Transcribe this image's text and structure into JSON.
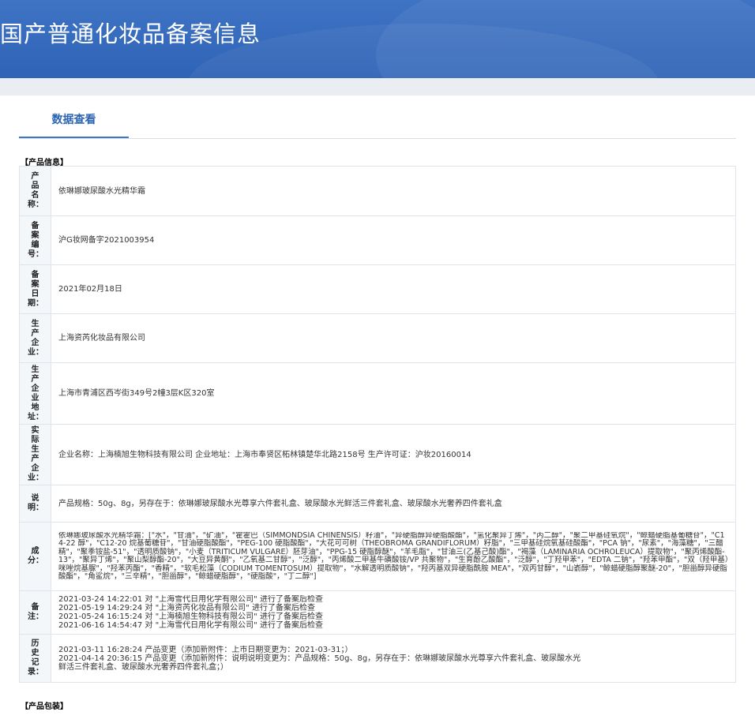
{
  "header": {
    "title": "国产普通化妆品备案信息"
  },
  "tabs": [
    {
      "label": "数据查看"
    }
  ],
  "product_info": {
    "section_label": "【产品信息】",
    "rows": [
      {
        "key": "产品名称：",
        "value": "依琳娜玻尿酸水光精华霜"
      },
      {
        "key": "备案编号：",
        "value": "沪G妆网备字2021003954"
      },
      {
        "key": "备案日期：",
        "value": "2021年02月18日"
      },
      {
        "key": "生产企业：",
        "value": "上海资芮化妆品有限公司"
      },
      {
        "key": "生产企业地址：",
        "value": "上海市青浦区西岑街349号2幢3层K区320室"
      },
      {
        "key": "实际生产企业：",
        "value": "企业名称：上海楠旭生物科技有限公司 企业地址：上海市奉贤区柘林镇楚华北路2158号 生产许可证：沪妆20160014"
      },
      {
        "key": "说明：",
        "value": "产品规格：50g、8g，另存在于：依琳娜玻尿酸水光尊享六件套礼盒、玻尿酸水光鲜活三件套礼盒、玻尿酸水光奢养四件套礼盒"
      },
      {
        "key": "成分：",
        "value": "依琳娜玻尿酸水光精华霜：[\"水\"，\"甘油\"，\"矿油\"，\"霍霍巴（SIMMONDSIA CHINENSIS）籽油\"，\"异硬脂醇异硬脂酸酯\"，\"氢化聚异丁烯\"，\"丙二醇\"，\"聚二甲基硅氧烷\"，\"鲸蜡硬脂基葡糖苷\"，\"C14-22 醇\"，\"C12-20 烷基葡糖苷\"，\"甘油硬脂酸酯\"，\"PEG-100 硬脂酸酯\"，\"大花可可树（THEOBROMA GRANDIFLORUM）籽脂\"，\"三甲基硅烷氧基硅酸酯\"，\"PCA 钠\"，\"尿素\"，\"海藻糖\"，\"三醋精\"，\"聚季铵盐-51\"，\"透明质酸钠\"，\"小麦（TRITICUM VULGARE）胚芽油\"，\"PPG-15 硬脂醇醚\"，\"羊毛脂\"，\"甘油三(乙基己酸)酯\"，\"褐藻（LAMINARIA OCHROLEUCA）提取物\"，\"聚丙烯酸酯-13\"，\"聚异丁烯\"，\"聚山梨醇酯-20\"，\"大豆异黄酮\"，\"乙氧基二甘醇\"，\"泛醇\"，\"丙烯酸二甲基牛磺酸铵/VP 共聚物\"，\"生育酚乙酸酯\"，\"泛醇\"，\"丁羟甲苯\"，\"EDTA 二钠\"，\"羟苯甲酯\"，\"双（羟甲基）咪唑烷基脲\"，\"羟苯丙酯\"，\"香精\"，\"软毛松藻（CODIUM TOMENTOSUM）提取物\"，\"水解透明质酸钠\"，\"羟丙基双异硬脂酰胺 MEA\"，\"双丙甘醇\"，\"山嵛醇\"，\"鲸蜡硬脂醇聚醚-20\"，\"胆甾醇异硬脂酸酯\"，\"角鲨烷\"，\"三辛精\"，\"胆甾醇\"，\"鲸蜡硬脂醇\"，\"硬脂酸\"，\"丁二醇\"]"
      },
      {
        "key": "备注：",
        "value": "2021-03-24 14:22:01 对 \"上海雪代日用化学有限公司\" 进行了备案后检查\n2021-05-19 14:29:24 对 \"上海资芮化妆品有限公司\" 进行了备案后检查\n2021-05-24 16:15:24 对 \"上海楠旭生物科技有限公司\" 进行了备案后检查\n2021-06-16 14:54:47 对 \"上海雪代日用化学有限公司\" 进行了备案后检查"
      },
      {
        "key": "历史记录：",
        "value": "2021-03-11 16:28:24 产品变更（添加新附件：上市日期变更为：2021-03-31；）\n2021-04-14 20:36:15 产品变更（添加新附件：说明说明变更为：产品规格：50g、8g，另存在于：依琳娜玻尿酸水光尊享六件套礼盒、玻尿酸水光鲜活三件套礼盒、玻尿酸水光奢养四件套礼盒；）"
      }
    ]
  },
  "packaging": {
    "section_label": "【产品包装】"
  }
}
